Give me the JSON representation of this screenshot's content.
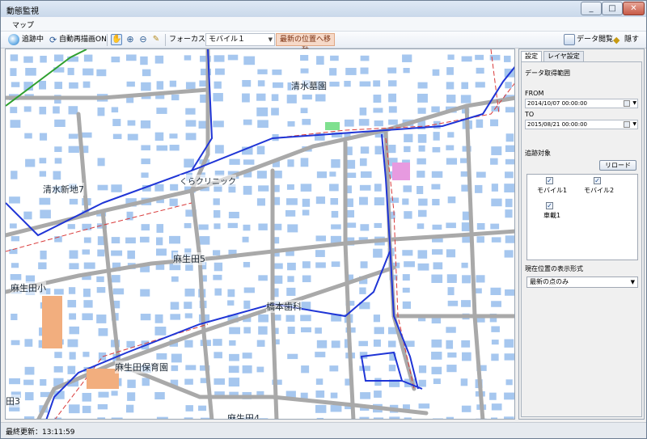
{
  "window": {
    "title": "動態監視",
    "minimize_icon": "minimize-icon",
    "maximize_icon": "maximize-icon",
    "close_icon": "close-icon"
  },
  "menu": {
    "items": [
      "マップ"
    ]
  },
  "toolbar": {
    "tracking_label": "追跡中",
    "auto_redraw_label": "自動再描画ON",
    "focus_label": "フォーカス",
    "focus_value": "モバイル１",
    "latest_position_button": "最新の位置へ移動",
    "data_view_label": "データ閲覧",
    "hide_label": "隠す",
    "icons": [
      "hand-pan-icon",
      "zoom-in-icon",
      "zoom-out-icon",
      "measure-icon"
    ]
  },
  "map": {
    "labels": [
      "清水墓園",
      "くらクリニック",
      "清水新地7",
      "麻生田5",
      "麻生田小",
      "橋本歯科",
      "麻生田保育園",
      "麻生田4",
      "田3"
    ]
  },
  "panel": {
    "tabs": [
      "設定",
      "レイヤ設定"
    ],
    "range_title": "データ取得範囲",
    "from_label": "FROM",
    "from_value": "2014/10/07 00:00:00",
    "to_label": "TO",
    "to_value": "2015/08/21 00:00:00",
    "targets_label": "追跡対象",
    "reload_button": "リロード",
    "targets": [
      {
        "label": "モバイル1",
        "checked": true
      },
      {
        "label": "モバイル2",
        "checked": true
      },
      {
        "label": "車載1",
        "checked": true
      }
    ],
    "display_format_label": "現在位置の表示形式",
    "display_format_value": "最新の点のみ"
  },
  "status": {
    "text": "最終更新：13:11:59"
  }
}
